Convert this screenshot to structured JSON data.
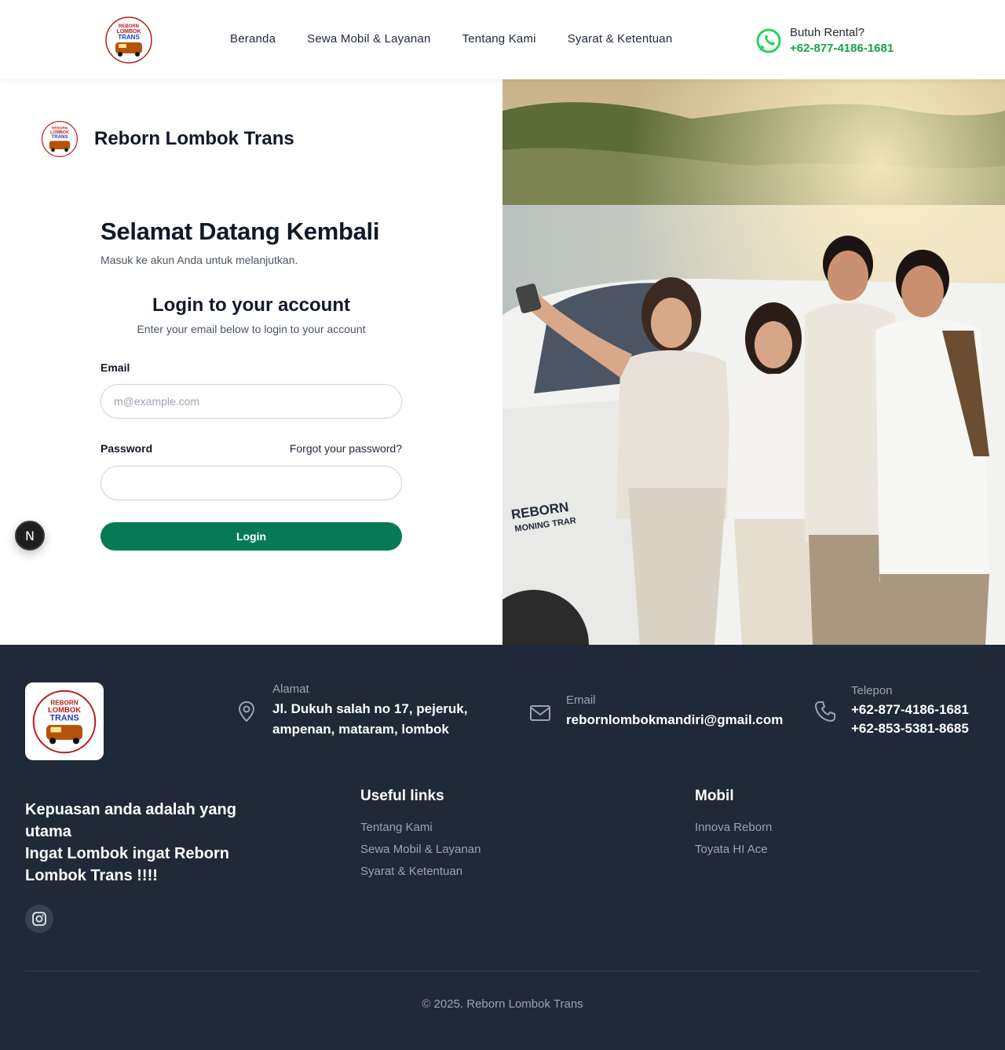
{
  "header": {
    "logo_text": [
      "REBORN",
      "LOMBOK",
      "TRANS"
    ],
    "nav": [
      "Beranda",
      "Sewa Mobil & Layanan",
      "Tentang Kami",
      "Syarat & Ketentuan"
    ],
    "contact_label": "Butuh Rental?",
    "contact_number": "+62-877-4186-1681"
  },
  "login_panel": {
    "brand_name": "Reborn Lombok Trans",
    "welcome_title": "Selamat Datang Kembali",
    "welcome_subtitle": "Masuk ke akun Anda untuk melanjutkan.",
    "form_title": "Login to your account",
    "form_subtitle": "Enter your email below to login to your account",
    "email_label": "Email",
    "email_placeholder": "m@example.com",
    "email_value": "",
    "password_label": "Password",
    "forgot_link": "Forgot your password?",
    "password_value": "",
    "login_button": "Login",
    "badge_letter": "N"
  },
  "photo": {
    "car_text_line1": "REBORN",
    "car_text_line2": "MONING TRAR"
  },
  "footer": {
    "address_title": "Alamat",
    "address_value_line1": "Jl. Dukuh salah no 17, pejeruk,",
    "address_value_line2": "ampenan, mataram, lombok",
    "email_title": "Email",
    "email_value": "rebornlombokmandiri@gmail.com",
    "phone_title": "Telepon",
    "phone_1": "+62-877-4186-1681",
    "phone_2": "+62-853-5381-8685",
    "tagline_line1": "Kepuasan anda adalah yang utama",
    "tagline_line2": "Ingat Lombok ingat Reborn Lombok Trans !!!!",
    "useful_links_title": "Useful links",
    "useful_links": [
      "Tentang Kami",
      "Sewa Mobil & Layanan",
      "Syarat & Ketentuan"
    ],
    "mobil_title": "Mobil",
    "mobil_links": [
      "Innova Reborn",
      "Toyata HI Ace"
    ],
    "copyright": "© 2025. Reborn Lombok Trans"
  },
  "colors": {
    "accent_green": "#057a55",
    "whatsapp_green": "#25d366",
    "phone_green": "#16a34a",
    "footer_bg": "#1f2937"
  },
  "icons": [
    "whatsapp-icon",
    "map-pin-icon",
    "mail-icon",
    "phone-icon",
    "instagram-icon"
  ]
}
